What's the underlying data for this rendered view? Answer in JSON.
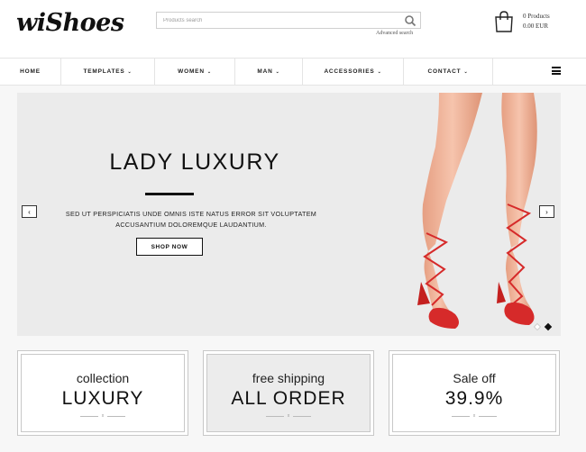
{
  "header": {
    "logo": "wiShoes",
    "search_placeholder": "Products search",
    "search_value": "",
    "advanced_search": "Advanced search",
    "cart_count": "0 Products",
    "cart_total": "0.00 EUR"
  },
  "nav": {
    "items": [
      {
        "label": "HOME",
        "caret": ""
      },
      {
        "label": "TEMPLATES",
        "caret": "⌄"
      },
      {
        "label": "WOMEN",
        "caret": "⌄"
      },
      {
        "label": "MAN",
        "caret": "⌄"
      },
      {
        "label": "ACCESSORIES",
        "caret": "⌄"
      },
      {
        "label": "CONTACT",
        "caret": "⌄"
      }
    ]
  },
  "banner": {
    "title": "LADY LUXURY",
    "text": "SED UT PERSPICIATIS UNDE OMNIS ISTE NATUS ERROR SIT VOLUPTATEM ACCUSANTIUM DOLOREMQUE LAUDANTIUM.",
    "button": "SHOP NOW",
    "prev": "‹",
    "next": "›",
    "slide_count": 2,
    "active_slide": 2
  },
  "promos": [
    {
      "top": "collection",
      "main": "LUXURY",
      "mark": "x"
    },
    {
      "top": "free shipping",
      "main": "ALL ORDER",
      "mark": "x"
    },
    {
      "top": "Sale off",
      "main": "39.9%",
      "mark": "x"
    }
  ],
  "colors": {
    "accent": "#d62a2a",
    "banner_bg": "#ebebeb",
    "skin": "#f1b59a"
  }
}
